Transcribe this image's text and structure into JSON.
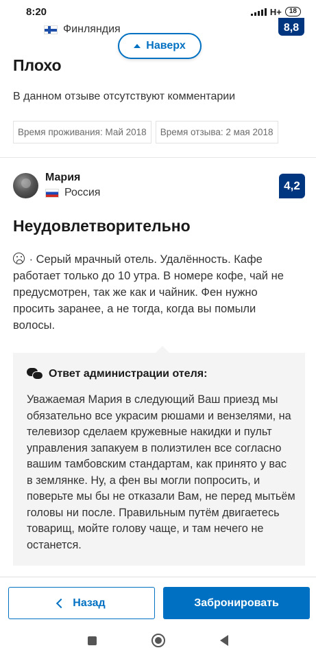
{
  "status_bar": {
    "time": "8:20",
    "network": "H+",
    "battery": "18"
  },
  "previous_review": {
    "country": "Финляндия",
    "score_fragment": "8,8",
    "title": "Плохо",
    "no_comments": "В данном отзыве отсутствуют комментарии",
    "stay_time": "Время проживания: Май 2018",
    "review_time": "Время отзыва: 2 мая 2018"
  },
  "up_button": {
    "label": "Наверх"
  },
  "review": {
    "reviewer_name": "Мария",
    "country": "Россия",
    "score": "4,2",
    "title": "Неудовлетворительно",
    "body": "· Серый мрачный отель. Удалённость. Кафе работает только до 10 утра. В номере кофе, чай не предусмотрен, так же как и чайник. Фен нужно просить заранее, а не тогда, когда вы помыли волосы."
  },
  "hotel_response": {
    "header": "Ответ администрации отеля:",
    "text": "Уважаемая Мария в следующий Ваш приезд мы обязательно все украсим рюшами и вензелями, на телевизор сделаем кружевные накидки и пульт управления запакуем в полиэтилен все согласно вашим тамбовским стандартам, как принято у вас в землянке. Ну, а фен вы могли попросить, и поверьте мы бы не отказали Вам, не перед мытьём головы ни после. Правильным путём двигаетесь товарищ, мойте голову чаще, и там нечего не останется."
  },
  "actions": {
    "back_label": "Назад",
    "book_label": "Забронировать"
  },
  "colors": {
    "brand_blue": "#0071c2",
    "score_navy": "#003580"
  }
}
